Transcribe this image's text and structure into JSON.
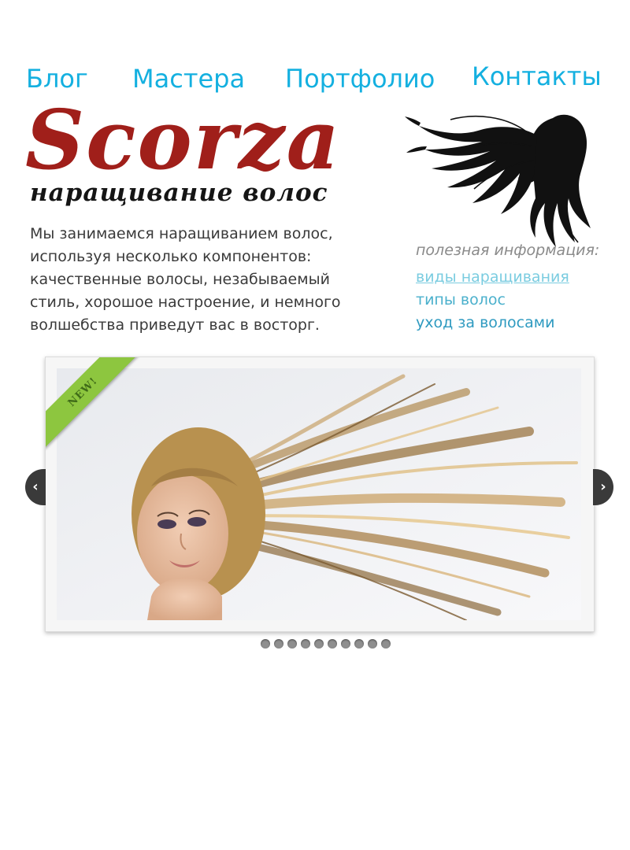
{
  "nav": {
    "items": [
      {
        "label": "Блог"
      },
      {
        "label": "Мастера"
      },
      {
        "label": "Портфолио"
      },
      {
        "label": "Контакты"
      }
    ]
  },
  "brand": {
    "name": "Scorza",
    "tagline": "наращивание волос"
  },
  "intro": {
    "text": "Мы занимаемся наращиванием волос, используя несколько компонентов: качественные волосы, незабываемый стиль, хорошое настроение, и немного волшебства приведут вас в восторг."
  },
  "useful": {
    "title": "полезная информация:",
    "links": [
      {
        "label": "виды наращивания"
      },
      {
        "label": "типы волос"
      },
      {
        "label": "уход за волосами"
      }
    ]
  },
  "slider": {
    "badge": "NEW!",
    "prev_icon": "chevron-left-icon",
    "next_icon": "chevron-right-icon",
    "prev_glyph": "‹",
    "next_glyph": "›",
    "dot_count": 10
  },
  "colors": {
    "nav": "#14b0e0",
    "logo": "#a01f1a",
    "ribbon": "#8dc63f",
    "link": "#4ab0cc"
  }
}
